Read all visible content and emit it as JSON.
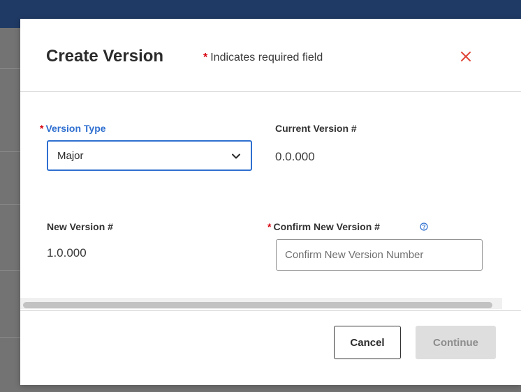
{
  "modal": {
    "title": "Create Version",
    "required_star": "*",
    "required_note": "Indicates required field",
    "close_icon": "close-icon"
  },
  "form": {
    "version_type": {
      "required_star": "*",
      "label": "Version Type",
      "selected": "Major"
    },
    "current_version": {
      "label": "Current Version #",
      "value": "0.0.000"
    },
    "new_version": {
      "label": "New Version #",
      "value": "1.0.000"
    },
    "confirm_version": {
      "required_star": "*",
      "label": "Confirm New Version #",
      "placeholder": "Confirm New Version Number",
      "value": "",
      "help_icon": "help-circle-icon"
    }
  },
  "footer": {
    "cancel_label": "Cancel",
    "continue_label": "Continue"
  },
  "colors": {
    "accent": "#2f6fd0",
    "required": "#d8000c",
    "close": "#e0473a",
    "disabled_button_bg": "#dedede",
    "header_bar": "#1f3a64"
  }
}
